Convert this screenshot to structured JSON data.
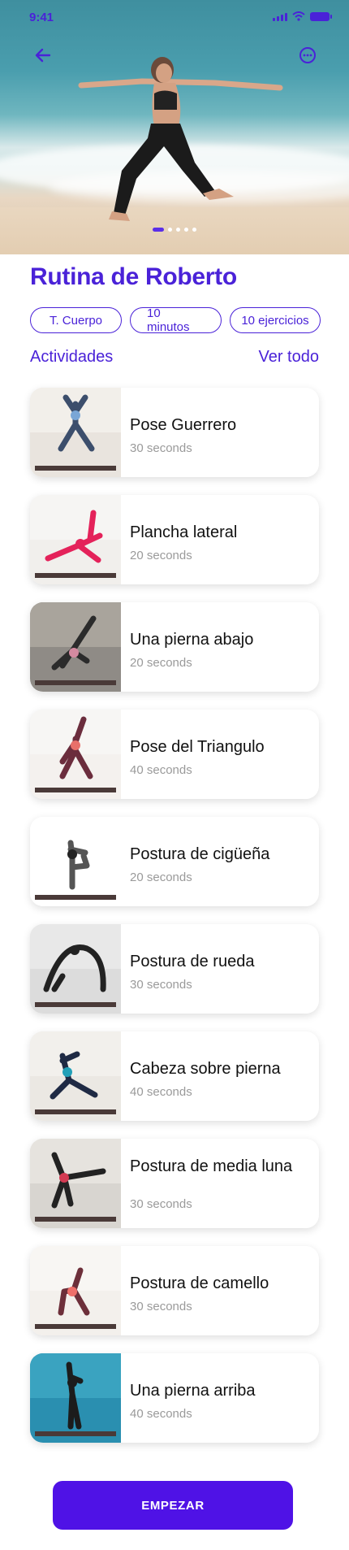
{
  "status_bar": {
    "time": "9:41"
  },
  "hero": {
    "image": "woman-warrior-pose-beach",
    "carousel_pages": 5,
    "active_page": 1
  },
  "header": {
    "back_icon": "arrow-left-icon",
    "more_icon": "more-options-icon"
  },
  "routine": {
    "title": "Rutina de Roberto",
    "tags": [
      "T. Cuerpo",
      "10 minutos",
      "10 ejercicios"
    ]
  },
  "activities": {
    "title": "Actividades",
    "see_all": "Ver todo",
    "items": [
      {
        "name": "Pose Guerrero",
        "duration": "30 seconds",
        "bg": "#e9e4de",
        "top": "#f2efea",
        "shirt": "#7aa6d6",
        "pants": "#3c4e6c"
      },
      {
        "name": "Plancha lateral",
        "duration": "20 seconds",
        "bg": "#f1efec",
        "top": "#f6f5f3",
        "shirt": "#e4225a",
        "pants": "#e4225a"
      },
      {
        "name": "Una pierna abajo",
        "duration": "20 seconds",
        "bg": "#8f8b86",
        "top": "#a9a49c",
        "shirt": "#d48aa0",
        "pants": "#2b2b2b"
      },
      {
        "name": "Pose del Triangulo",
        "duration": "40 seconds",
        "bg": "#f4f1ee",
        "top": "#f7f6f4",
        "shirt": "#e8706a",
        "pants": "#6b2d3d"
      },
      {
        "name": "Postura de cigüeña",
        "duration": "20 seconds",
        "bg": "#ffffff",
        "top": "#ffffff",
        "shirt": "#222222",
        "pants": "#555555"
      },
      {
        "name": "Postura de rueda",
        "duration": "30 seconds",
        "bg": "#dcdcdc",
        "top": "#e8e8e8",
        "shirt": "#222222",
        "pants": "#222222"
      },
      {
        "name": "Cabeza sobre pierna",
        "duration": "40 seconds",
        "bg": "#ebe8e3",
        "top": "#f2f0ec",
        "shirt": "#22a0b8",
        "pants": "#1f2a44"
      },
      {
        "name": "Postura de media luna",
        "duration": "30 seconds",
        "bg": "#d8d5d0",
        "top": "#e6e3de",
        "shirt": "#d33a52",
        "pants": "#222222"
      },
      {
        "name": "Postura de camello",
        "duration": "30 seconds",
        "bg": "#f3f0ec",
        "top": "#f8f6f3",
        "shirt": "#ef6f6a",
        "pants": "#6d2f3a"
      },
      {
        "name": "Una pierna arriba",
        "duration": "40 seconds",
        "bg": "#2a8fb0",
        "top": "#3aa3c0",
        "shirt": "#1c1c1c",
        "pants": "#1c1c1c"
      }
    ]
  },
  "cta": {
    "label": "EMPEZAR"
  },
  "colors": {
    "accent": "#4a22d8",
    "button": "#4f12e6",
    "muted": "#9a9a9a"
  }
}
